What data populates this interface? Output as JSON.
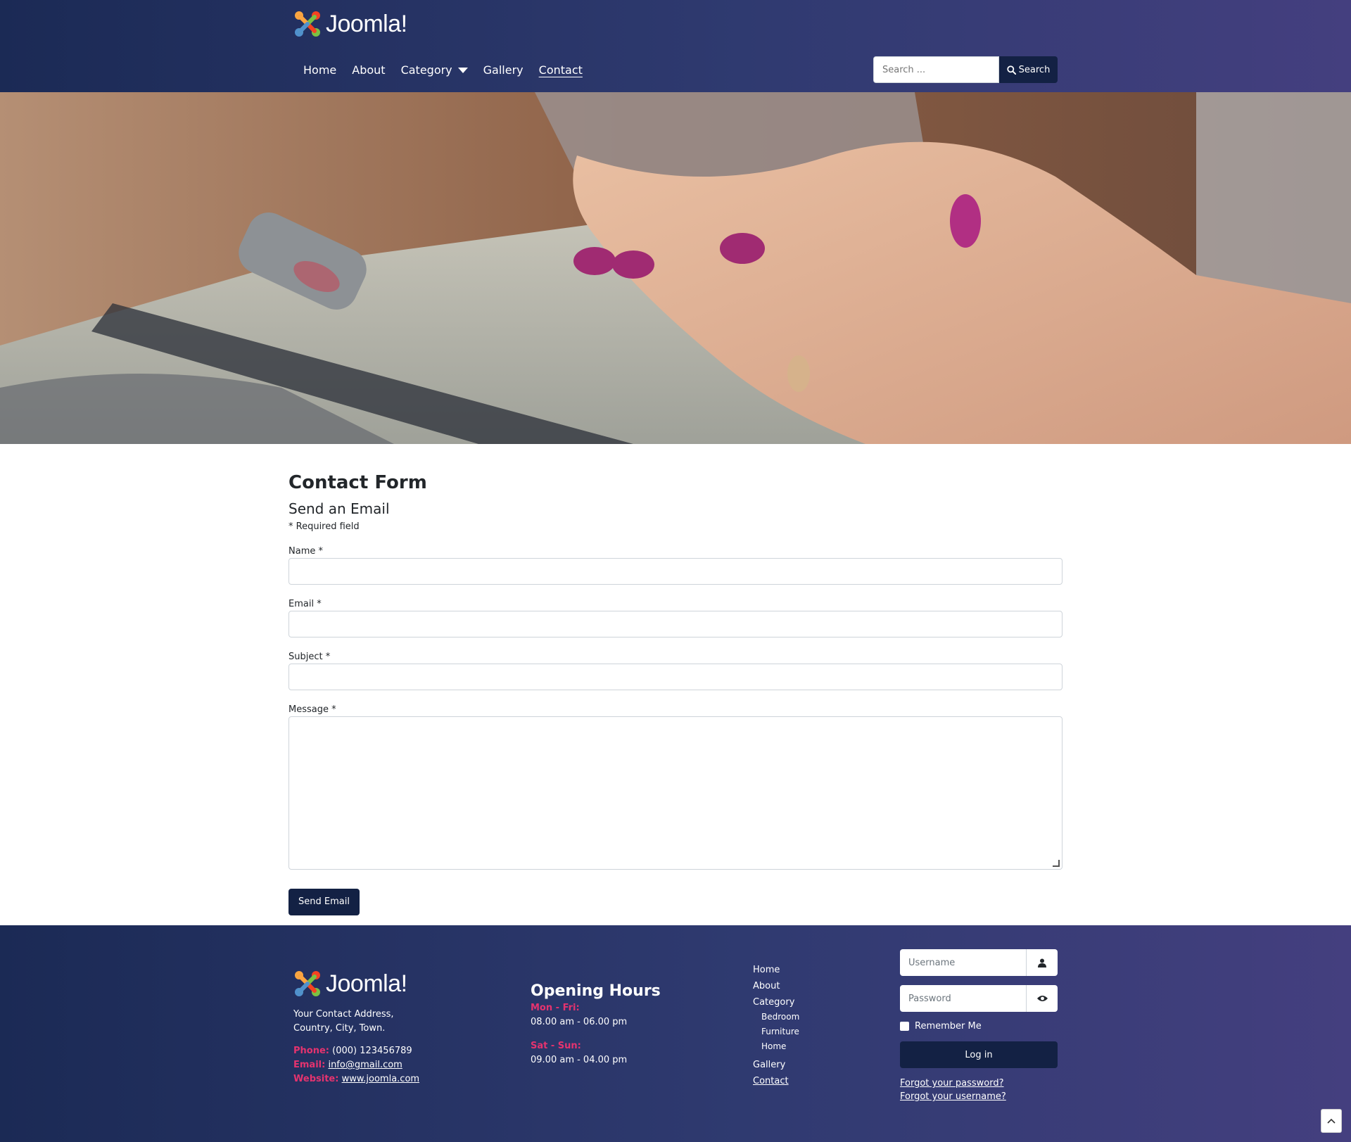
{
  "brand": {
    "name": "Joomla!"
  },
  "nav": {
    "items": [
      {
        "label": "Home"
      },
      {
        "label": "About"
      },
      {
        "label": "Category"
      },
      {
        "label": "Gallery"
      },
      {
        "label": "Contact"
      }
    ]
  },
  "search": {
    "placeholder": "Search ...",
    "button_label": "Search"
  },
  "form": {
    "title": "Contact Form",
    "subtitle": "Send an Email",
    "required_note": "* Required field",
    "fields": [
      {
        "label": "Name *"
      },
      {
        "label": "Email *"
      },
      {
        "label": "Subject *"
      },
      {
        "label": "Message *"
      }
    ],
    "submit_label": "Send Email"
  },
  "footer": {
    "address_line1": "Your Contact Address,",
    "address_line2": "Country, City, Town.",
    "phone_label": "Phone:",
    "phone_value": "(000) 123456789",
    "email_label": "Email:",
    "email_value": "info@gmail.com",
    "website_label": "Website:",
    "website_value": "www.joomla.com",
    "hours_title": "Opening Hours",
    "weekday_label": "Mon - Fri:",
    "weekday_hours": "08.00 am - 06.00 pm",
    "weekend_label": "Sat - Sun:",
    "weekend_hours": "09.00 am - 04.00 pm",
    "menu": {
      "home": "Home",
      "about": "About",
      "category": "Category",
      "sub": [
        "Bedroom",
        "Furniture",
        "Home"
      ],
      "gallery": "Gallery",
      "contact": "Contact"
    },
    "login": {
      "username_placeholder": "Username",
      "password_placeholder": "Password",
      "remember_label": "Remember Me",
      "login_label": "Log in",
      "forgot_password": "Forgot your password?",
      "forgot_username": "Forgot your username?"
    }
  },
  "colors": {
    "header_bg": "#1b2a55",
    "header_bg_end": "#443f7f",
    "button": "#132144",
    "accent_pink": "#e5336f"
  },
  "icons": {
    "search": "search-icon",
    "user": "user-icon",
    "eye": "eye-icon",
    "chevron_up": "chevron-up-icon",
    "caret": "caret-down-icon"
  }
}
